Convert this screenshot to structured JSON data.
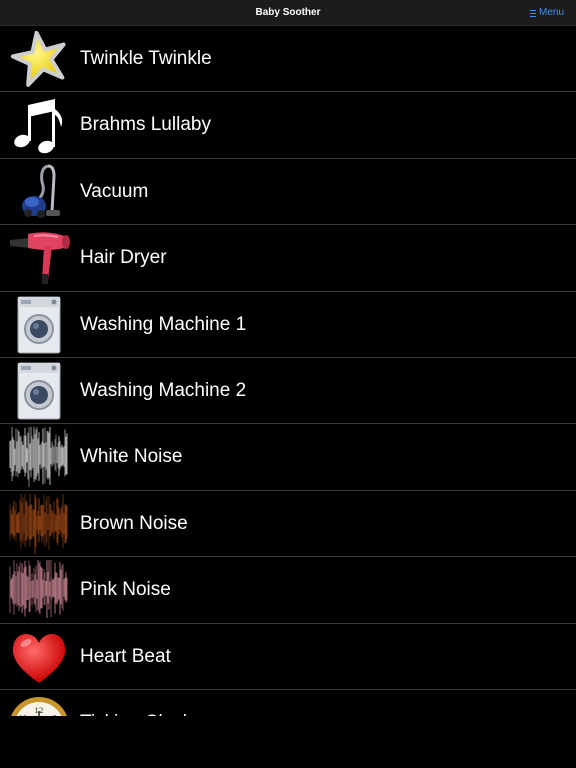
{
  "navbar": {
    "title": "Baby Soother",
    "menu_label": "Menu",
    "menu_icon": "hamburger-icon"
  },
  "sounds": [
    {
      "label": "Twinkle Twinkle",
      "icon": "star-icon"
    },
    {
      "label": "Brahms Lullaby",
      "icon": "music-note-icon"
    },
    {
      "label": "Vacuum",
      "icon": "vacuum-icon"
    },
    {
      "label": "Hair Dryer",
      "icon": "hair-dryer-icon"
    },
    {
      "label": "Washing Machine 1",
      "icon": "washing-machine-icon"
    },
    {
      "label": "Washing Machine 2",
      "icon": "washing-machine-icon"
    },
    {
      "label": "White Noise",
      "icon": "white-noise-waveform-icon"
    },
    {
      "label": "Brown Noise",
      "icon": "brown-noise-waveform-icon"
    },
    {
      "label": "Pink Noise",
      "icon": "pink-noise-waveform-icon"
    },
    {
      "label": "Heart Beat",
      "icon": "heart-icon"
    },
    {
      "label": "Ticking Clock",
      "icon": "clock-icon"
    }
  ],
  "colors": {
    "accent": "#3a8dff",
    "background": "#000000",
    "navbar": "#1c1c1c",
    "separator": "#3a3a3a"
  }
}
